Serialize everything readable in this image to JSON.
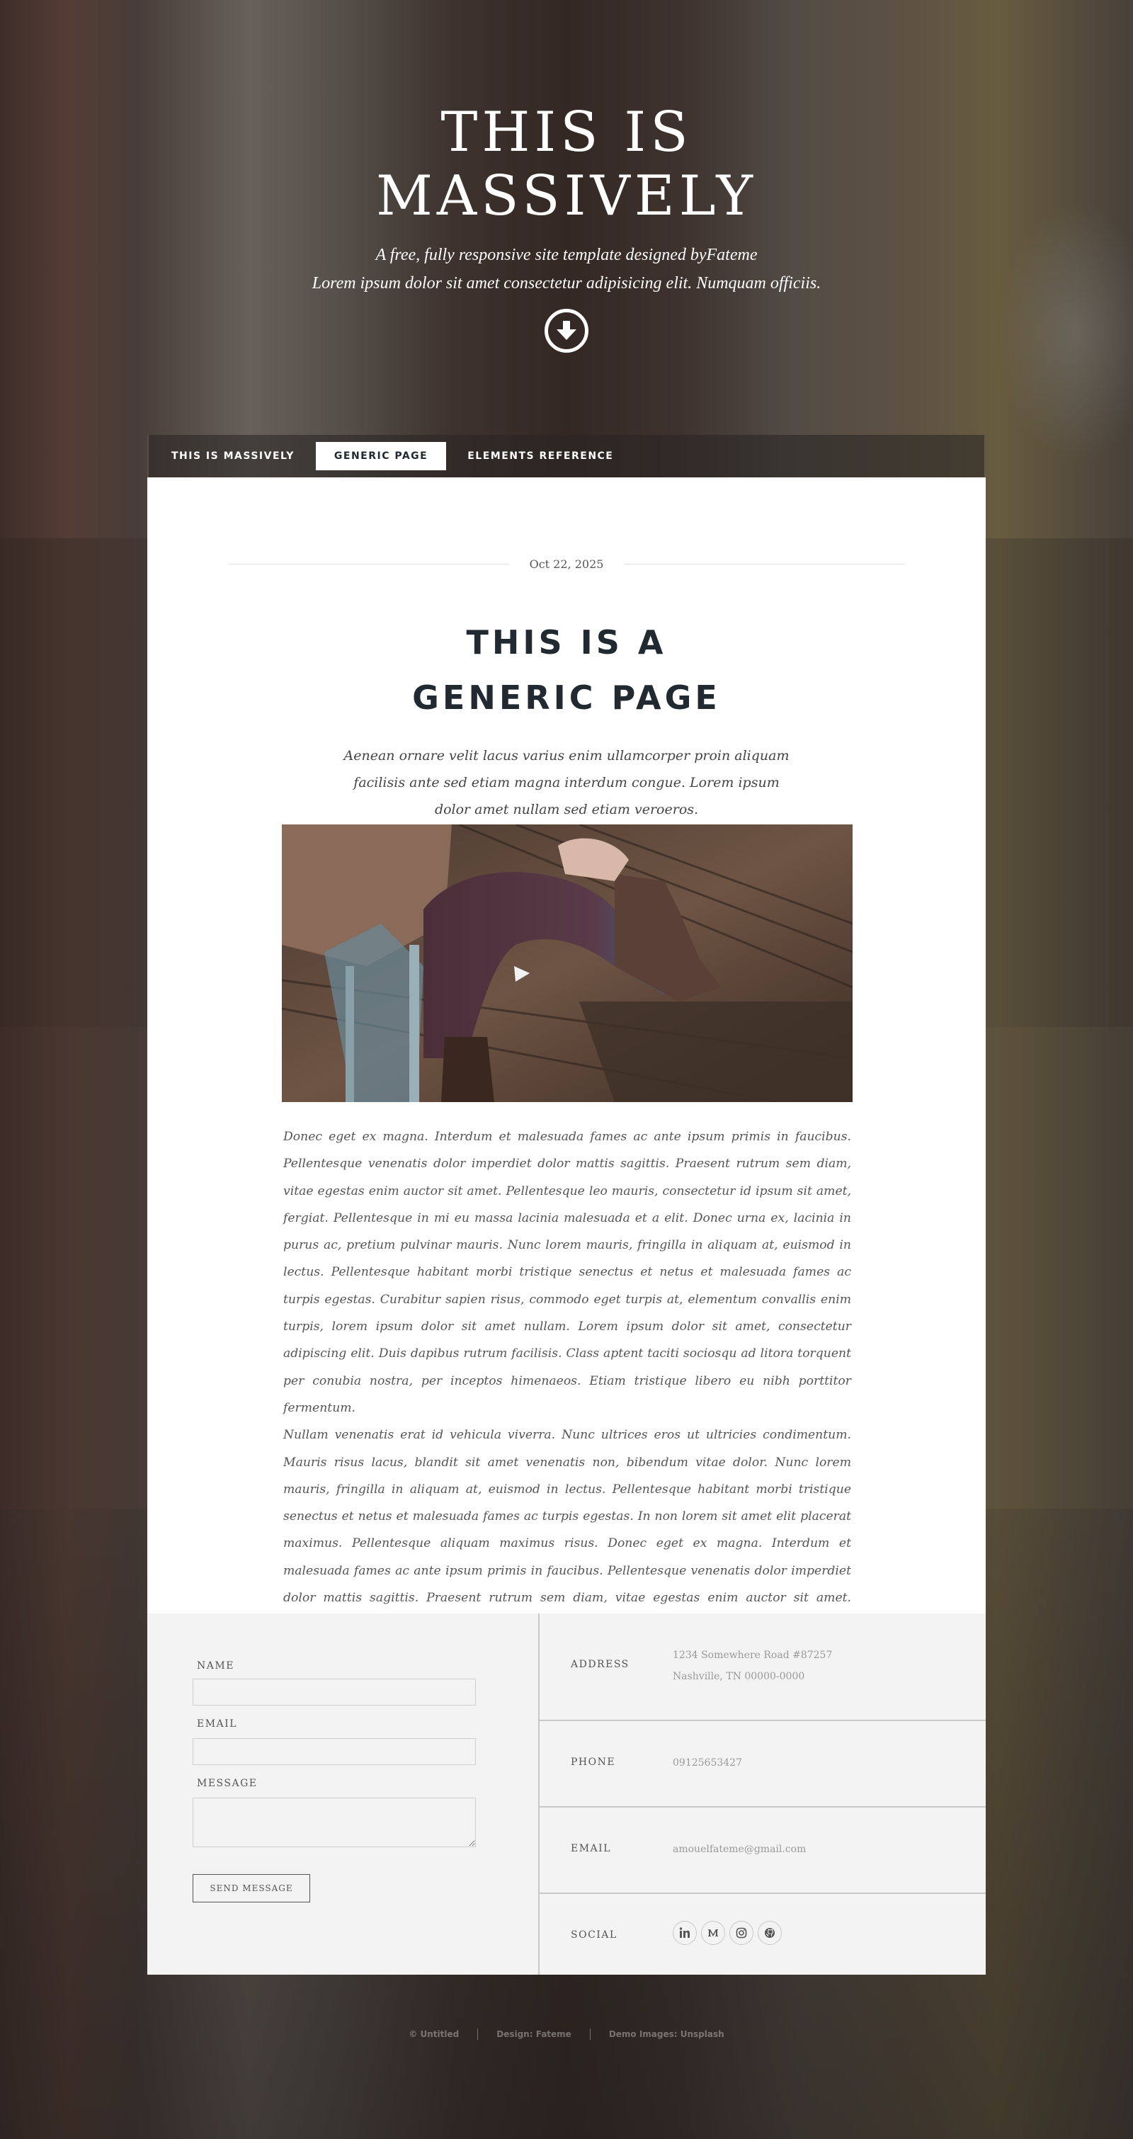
{
  "intro": {
    "title_line1": "THIS IS",
    "title_line2": "MASSIVELY",
    "tagline_line1": "A free, fully responsive site template designed byFateme",
    "tagline_line2": "Lorem ipsum dolor sit amet consectetur adipisicing elit. Numquam officiis.",
    "down_icon": "arrow-down-circle-icon"
  },
  "nav": {
    "items": [
      {
        "label": "THIS IS MASSIVELY",
        "active": false
      },
      {
        "label": "GENERIC PAGE",
        "active": true
      },
      {
        "label": "ELEMENTS REFERENCE",
        "active": false
      }
    ]
  },
  "post": {
    "date": "Oct 22, 2025",
    "title_line1": "THIS IS A",
    "title_line2": "GENERIC PAGE",
    "lead": "Aenean ornare velit lacus varius enim ullamcorper proin aliquam facilisis ante sed etiam magna interdum congue. Lorem ipsum dolor amet nullam sed etiam veroeros.",
    "paragraph1": "Donec eget ex magna. Interdum et malesuada fames ac ante ipsum primis in faucibus. Pellentesque venenatis dolor imperdiet dolor mattis sagittis. Praesent rutrum sem diam, vitae egestas enim auctor sit amet. Pellentesque leo mauris, consectetur id ipsum sit amet, fergiat. Pellentesque in mi eu massa lacinia malesuada et a elit. Donec urna ex, lacinia in purus ac, pretium pulvinar mauris. Nunc lorem mauris, fringilla in aliquam at, euismod in lectus. Pellentesque habitant morbi tristique senectus et netus et malesuada fames ac turpis egestas. Curabitur sapien risus, commodo eget turpis at, elementum convallis enim turpis, lorem ipsum dolor sit amet nullam. Lorem ipsum dolor sit amet, consectetur adipiscing elit. Duis dapibus rutrum facilisis. Class aptent taciti sociosqu ad litora torquent per conubia nostra, per inceptos himenaeos. Etiam tristique libero eu nibh porttitor fermentum.",
    "paragraph2": "Nullam venenatis erat id vehicula viverra. Nunc ultrices eros ut ultricies condimentum. Mauris risus lacus, blandit sit amet venenatis non, bibendum vitae dolor. Nunc lorem mauris, fringilla in aliquam at, euismod in lectus. Pellentesque habitant morbi tristique senectus et netus et malesuada fames ac turpis egestas. In non lorem sit amet elit placerat maximus. Pellentesque aliquam maximus risus. Donec eget ex magna. Interdum et malesuada fames ac ante ipsum primis in faucibus. Pellentesque venenatis dolor imperdiet dolor mattis sagittis. Praesent rutrum sem diam, vitae egestas enim auctor sit amet. Pellentesque leo mauris, consectetur id ipsum."
  },
  "form": {
    "name_label": "NAME",
    "email_label": "EMAIL",
    "message_label": "MESSAGE",
    "name_value": "",
    "email_value": "",
    "message_value": "",
    "send_label": "SEND MESSAGE"
  },
  "contact": {
    "address_label": "ADDRESS",
    "address_value": "1234 Somewhere Road #87257 Nashville, TN 00000-0000",
    "phone_label": "PHONE",
    "phone_value": "09125653427",
    "email_label": "EMAIL",
    "email_value": "amouelfateme@gmail.com",
    "social_label": "SOCIAL",
    "social_icons": [
      "linkedin-icon",
      "medium-icon",
      "instagram-icon",
      "github-icon"
    ]
  },
  "copyright": {
    "owner": "© Untitled",
    "design": "Design: Fateme",
    "images": "Demo Images: Unsplash"
  },
  "colors": {
    "dark_text": "#212931",
    "panel_bg": "#f3f3f3",
    "white": "#ffffff"
  }
}
